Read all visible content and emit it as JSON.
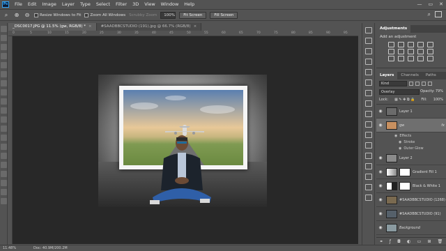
{
  "menu": {
    "logo": "Ps",
    "items": [
      "File",
      "Edit",
      "Image",
      "Layer",
      "Type",
      "Select",
      "Filter",
      "3D",
      "View",
      "Window",
      "Help"
    ],
    "window_controls": [
      "—",
      "▭",
      "✕"
    ]
  },
  "options": {
    "resize_windows": "Resize Windows to Fit",
    "zoom_all": "Zoom All Windows",
    "scrubby_zoom": "Scrubby Zoom",
    "zoom_value": "100%",
    "fit_screen_1": "Fit Screen",
    "fit_screen_2": "Fill Screen"
  },
  "tabs": [
    {
      "label": "_DSC0017.JPG @ 11.5% (gw, RGB/8) *",
      "active": true
    },
    {
      "label": "#SAADBBCSTUDIO (191).jpg @ 66.7% (RGB/8)",
      "active": false
    }
  ],
  "ruler_ticks": [
    "0",
    "5",
    "10",
    "15",
    "20",
    "25",
    "30",
    "35",
    "40",
    "45",
    "50",
    "55",
    "60",
    "65",
    "70",
    "75",
    "80",
    "85",
    "90",
    "95"
  ],
  "status": {
    "zoom": "11.48%",
    "doc": "Doc: 40.9M/200.2M"
  },
  "adjustments": {
    "tab_label": "Adjustments",
    "add_label": "Add an adjustment"
  },
  "layers": {
    "tabs": [
      "Layers",
      "Channels",
      "Paths"
    ],
    "kind": "Kind",
    "blend_mode": "Overlay",
    "opacity_label": "Opacity:",
    "opacity_value": "79%",
    "lock_label": "Lock:",
    "fill_label": "Fill:",
    "fill_value": "100%",
    "items": [
      {
        "name": "Layer 1",
        "thumb": "#6b6b6b"
      },
      {
        "name": "gw",
        "thumb": "#c89060",
        "selected": true,
        "fx": "fx"
      },
      {
        "name": "Layer 2",
        "thumb": "#8a8a8a"
      },
      {
        "name": "Gradient Fill 1",
        "thumb": "#dcdcdc"
      },
      {
        "name": "Black & White 1",
        "thumb": "#f0f0f0"
      },
      {
        "name": "#SAADBBCSTUDIO (1268)",
        "thumb": "#7a6a50"
      },
      {
        "name": "#SAADBBCSTUDIO (91)",
        "thumb": "#55606a"
      },
      {
        "name": "Background",
        "thumb": "#8a9aa0"
      }
    ],
    "effects_label": "Effects",
    "effect_1": "Stroke",
    "effect_2": "Outer Glow"
  },
  "colors": {
    "selected_layer": "#6f6f6f",
    "canvas_bg": "#282828",
    "ps_blue": "#31a8ff"
  }
}
